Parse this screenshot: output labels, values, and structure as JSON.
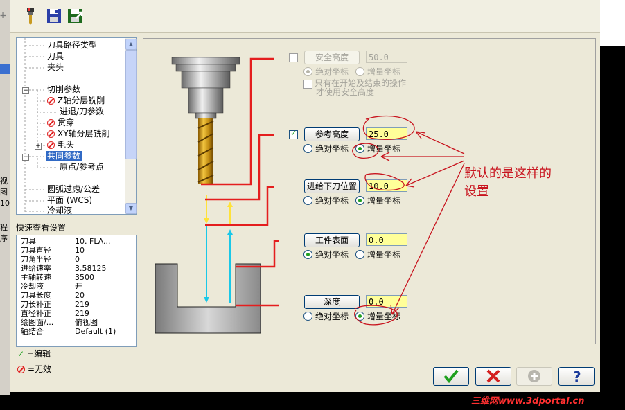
{
  "tree": {
    "items": [
      {
        "label": "刀具路径类型"
      },
      {
        "label": "刀具"
      },
      {
        "label": "夹头"
      },
      {
        "label": "切削参数"
      },
      {
        "label": "Z轴分层铣削"
      },
      {
        "label": "进退/刀参数"
      },
      {
        "label": "贯穿"
      },
      {
        "label": "XY轴分层铣削"
      },
      {
        "label": "毛头"
      },
      {
        "label": "共同参数"
      },
      {
        "label": "原点/参考点"
      },
      {
        "label": "圆弧过虑/公差"
      },
      {
        "label": "平面 (WCS)"
      },
      {
        "label": "冷却液"
      }
    ]
  },
  "quick_view": {
    "title": "快速查看设置",
    "rows": [
      {
        "key": "刀具",
        "value": "10. FLA..."
      },
      {
        "key": "刀具直径",
        "value": "10"
      },
      {
        "key": "刀角半径",
        "value": "0"
      },
      {
        "key": "进给速率",
        "value": "3.58125"
      },
      {
        "key": "主轴转速",
        "value": "3500"
      },
      {
        "key": "冷却液",
        "value": "开"
      },
      {
        "key": "刀具长度",
        "value": "20"
      },
      {
        "key": "刀长补正",
        "value": "219"
      },
      {
        "key": "直径补正",
        "value": "219"
      },
      {
        "key": "绘图面/...",
        "value": "俯视图"
      },
      {
        "key": "轴结合",
        "value": "Default (1)"
      }
    ]
  },
  "legend": {
    "edit": "=编辑",
    "invalid": "=无效"
  },
  "params": {
    "safety": {
      "label": "安全高度",
      "value": "50.0",
      "absolute": "绝对坐标",
      "incremental": "增量坐标",
      "only_note_1": "只有在开始及结束的操作",
      "only_note_2": "才使用安全高度"
    },
    "reference": {
      "label": "参考高度",
      "value": "25.0",
      "absolute": "绝对坐标",
      "incremental": "增量坐标"
    },
    "feed_plane": {
      "label": "进给下刀位置",
      "value": "10.0",
      "absolute": "绝对坐标",
      "incremental": "增量坐标"
    },
    "top_of_stock": {
      "label": "工件表面",
      "value": "0.0",
      "absolute": "绝对坐标",
      "incremental": "增量坐标"
    },
    "depth": {
      "label": "深度",
      "value": "0.0",
      "absolute": "绝对坐标",
      "incremental": "增量坐标"
    }
  },
  "annotation": {
    "line1": "默认的是这样的",
    "line2": "设置"
  },
  "left_strip": {
    "label1": "视图",
    "label2": "10",
    "label3": "程序"
  },
  "watermark": "三维网www.3dportal.cn",
  "colors": {
    "accent_red": "#e41e1e",
    "ok_green": "#1fa01f",
    "cancel_red": "#d42020",
    "field_yellow": "#ffff99",
    "selection": "#316ac5"
  }
}
